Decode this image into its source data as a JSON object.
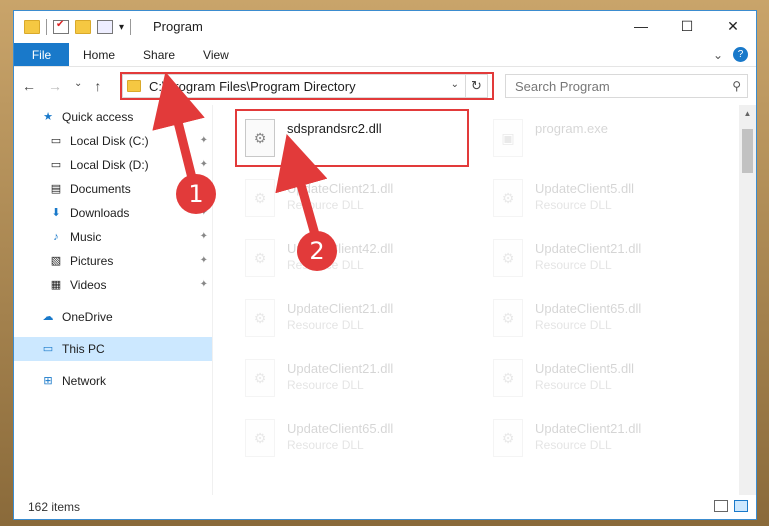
{
  "window": {
    "title": "Program",
    "minimize_glyph": "—",
    "maximize_glyph": "☐",
    "close_glyph": "✕"
  },
  "ribbon": {
    "tabs": [
      "File",
      "Home",
      "Share",
      "View"
    ],
    "expand_glyph": "⌄",
    "help_glyph": "?"
  },
  "nav": {
    "back_glyph": "←",
    "forward_glyph": "→",
    "recent_glyph": "⌄",
    "up_glyph": "↑",
    "address": "C:\\Program Files\\Program Directory",
    "dropdown_glyph": "⌄",
    "refresh_glyph": "↻",
    "search_placeholder": "Search Program",
    "search_glyph": "⚲"
  },
  "sidebar": {
    "items": [
      {
        "label": "Quick access",
        "icon": "star-icon",
        "glyph": "★"
      },
      {
        "label": "Local Disk (C:)",
        "icon": "drive-icon",
        "glyph": "▭",
        "pinned": true
      },
      {
        "label": "Local Disk (D:)",
        "icon": "drive-icon",
        "glyph": "▭",
        "pinned": true
      },
      {
        "label": "Documents",
        "icon": "documents-icon",
        "glyph": "▤",
        "pinned": true
      },
      {
        "label": "Downloads",
        "icon": "downloads-icon",
        "glyph": "⬇",
        "pinned": true
      },
      {
        "label": "Music",
        "icon": "music-icon",
        "glyph": "♪",
        "pinned": true
      },
      {
        "label": "Pictures",
        "icon": "pictures-icon",
        "glyph": "▧",
        "pinned": true
      },
      {
        "label": "Videos",
        "icon": "videos-icon",
        "glyph": "▦",
        "pinned": true
      },
      {
        "label": "OneDrive",
        "icon": "onedrive-icon",
        "glyph": "☁"
      },
      {
        "label": "This PC",
        "icon": "computer-icon",
        "glyph": "▭"
      },
      {
        "label": "Network",
        "icon": "network-icon",
        "glyph": "⊞"
      }
    ],
    "pin_glyph": "✦"
  },
  "files": [
    {
      "name": "sdsprandsrc2.dll",
      "type": "",
      "highlighted": true
    },
    {
      "name": "program.exe",
      "type": ""
    },
    {
      "name": "UpdateClient21.dll",
      "type": "Resource DLL"
    },
    {
      "name": "UpdateClient5.dll",
      "type": "Resource DLL"
    },
    {
      "name": "UpdateClient42.dll",
      "type": "Resource DLL"
    },
    {
      "name": "UpdateClient21.dll",
      "type": "Resource DLL"
    },
    {
      "name": "UpdateClient21.dll",
      "type": "Resource DLL"
    },
    {
      "name": "UpdateClient65.dll",
      "type": "Resource DLL"
    },
    {
      "name": "UpdateClient21.dll",
      "type": "Resource DLL"
    },
    {
      "name": "UpdateClient5.dll",
      "type": "Resource DLL"
    },
    {
      "name": "UpdateClient65.dll",
      "type": "Resource DLL"
    },
    {
      "name": "UpdateClient21.dll",
      "type": "Resource DLL"
    }
  ],
  "file_icon_glyph": "⚙",
  "exe_icon_glyph": "▣",
  "status": {
    "item_count": "162 items"
  },
  "annotations": {
    "callout_1": "1",
    "callout_2": "2",
    "color": "#e23a3a"
  },
  "colors": {
    "accent": "#1979ca",
    "selected": "#cce8ff"
  }
}
